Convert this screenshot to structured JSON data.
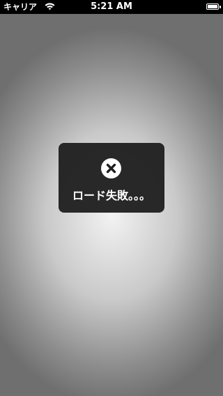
{
  "status_bar": {
    "carrier": "キャリア",
    "time": "5:21 AM",
    "wifi_icon": "wifi-icon",
    "battery_icon": "battery-icon",
    "battery_level": 1.0
  },
  "hud": {
    "icon": "close-circle-icon",
    "message": "ロード失敗。。。"
  },
  "colors": {
    "status_bar_bg": "#000000",
    "hud_bg": "#202020",
    "text": "#ffffff"
  }
}
